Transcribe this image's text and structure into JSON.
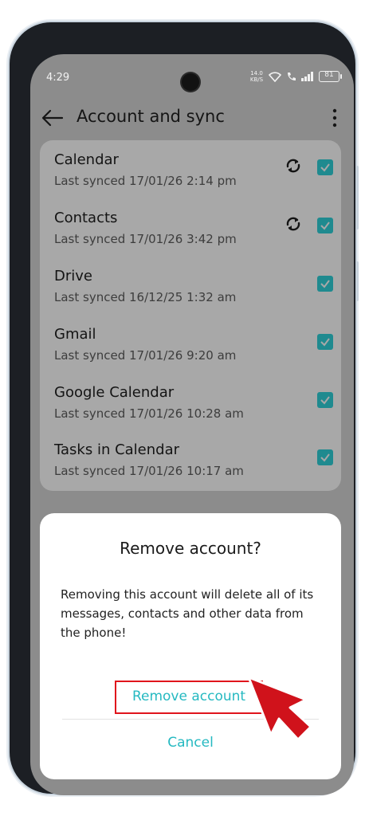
{
  "status_bar": {
    "time": "4:29",
    "net_speed": "14.0 KB/S",
    "battery": "81"
  },
  "app_bar": {
    "title": "Account and sync"
  },
  "accounts": [
    {
      "name": "Calendar",
      "last_synced": "Last synced 17/01/26 2:14 pm",
      "syncing": true,
      "checked": true
    },
    {
      "name": "Contacts",
      "last_synced": "Last synced 17/01/26 3:42 pm",
      "syncing": true,
      "checked": true
    },
    {
      "name": "Drive",
      "last_synced": "Last synced 16/12/25 1:32 am",
      "syncing": false,
      "checked": true
    },
    {
      "name": "Gmail",
      "last_synced": "Last synced 17/01/26 9:20 am",
      "syncing": false,
      "checked": true
    },
    {
      "name": "Google Calendar",
      "last_synced": "Last synced 17/01/26 10:28 am",
      "syncing": false,
      "checked": true
    },
    {
      "name": "Tasks in Calendar",
      "last_synced": "Last synced 17/01/26 10:17 am",
      "syncing": false,
      "checked": true
    }
  ],
  "dialog": {
    "title": "Remove account?",
    "message": "Removing this account will delete all of its messages, contacts and other data from the phone!",
    "confirm_label": "Remove account",
    "cancel_label": "Cancel"
  },
  "colors": {
    "accent": "#25b9c1",
    "checkbox": "#1f8a8f",
    "highlight": "#e0141c",
    "scrim": "#8c8c8c"
  }
}
